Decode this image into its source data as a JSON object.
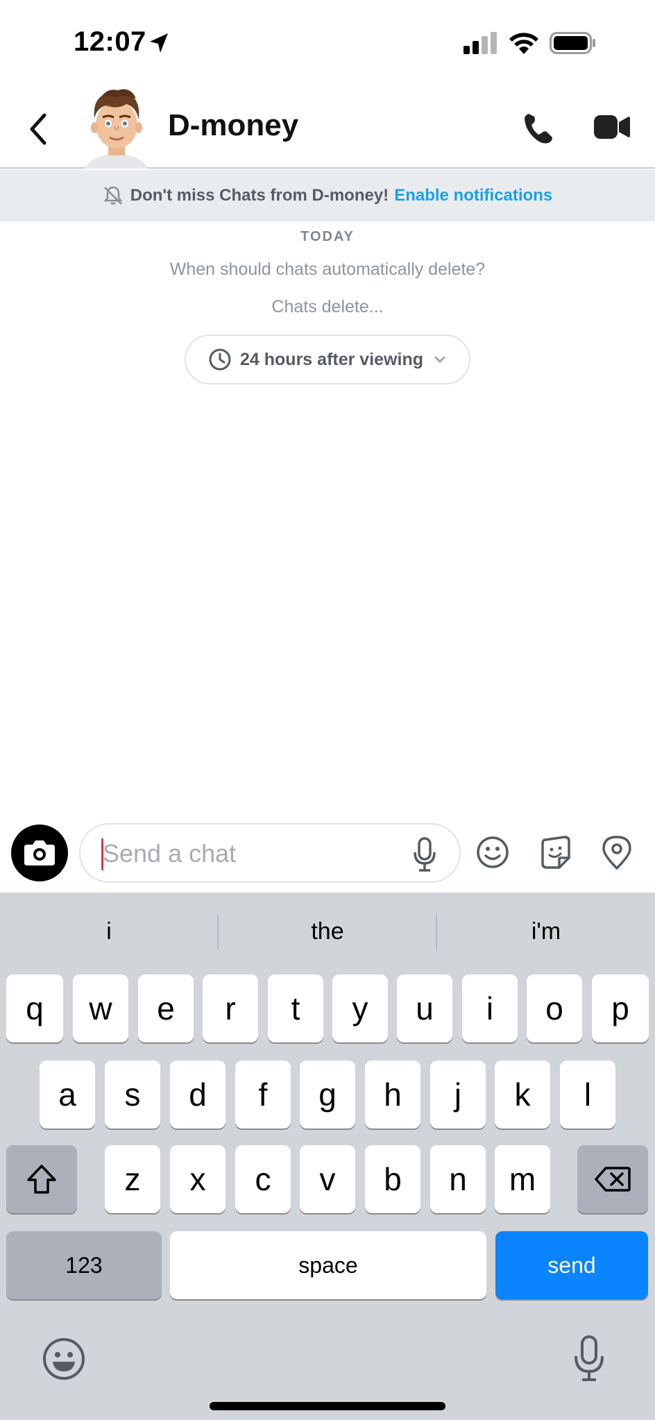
{
  "status_bar": {
    "time": "12:07",
    "icons": [
      "location-arrow-icon",
      "cellular-signal-icon",
      "wifi-icon",
      "battery-icon"
    ]
  },
  "header": {
    "title": "D-money",
    "back_icon": "chevron-left-icon",
    "avatar": "bitmoji-avatar",
    "call_icon": "phone-icon",
    "video_icon": "video-camera-icon"
  },
  "notification_banner": {
    "message": "Don't miss Chats from D-money!",
    "link": "Enable notifications",
    "icon": "bell-muted-icon"
  },
  "conversation": {
    "date_label": "TODAY",
    "question": "When should chats automatically delete?",
    "subtext": "Chats delete...",
    "delete_option": "24 hours after viewing"
  },
  "composer": {
    "input_value": "",
    "placeholder": "Send a chat",
    "icons": [
      "camera-icon",
      "microphone-icon",
      "emoji-icon",
      "sticker-icon",
      "location-pin-icon"
    ]
  },
  "keyboard": {
    "suggestions": [
      "i",
      "the",
      "i'm"
    ],
    "row1": [
      "q",
      "w",
      "e",
      "r",
      "t",
      "y",
      "u",
      "i",
      "o",
      "p"
    ],
    "row2": [
      "a",
      "s",
      "d",
      "f",
      "g",
      "h",
      "j",
      "k",
      "l"
    ],
    "row3": [
      "z",
      "x",
      "c",
      "v",
      "b",
      "n",
      "m"
    ],
    "numbers_label": "123",
    "space_label": "space",
    "send_label": "send",
    "accent_color": "#0a84ff"
  }
}
